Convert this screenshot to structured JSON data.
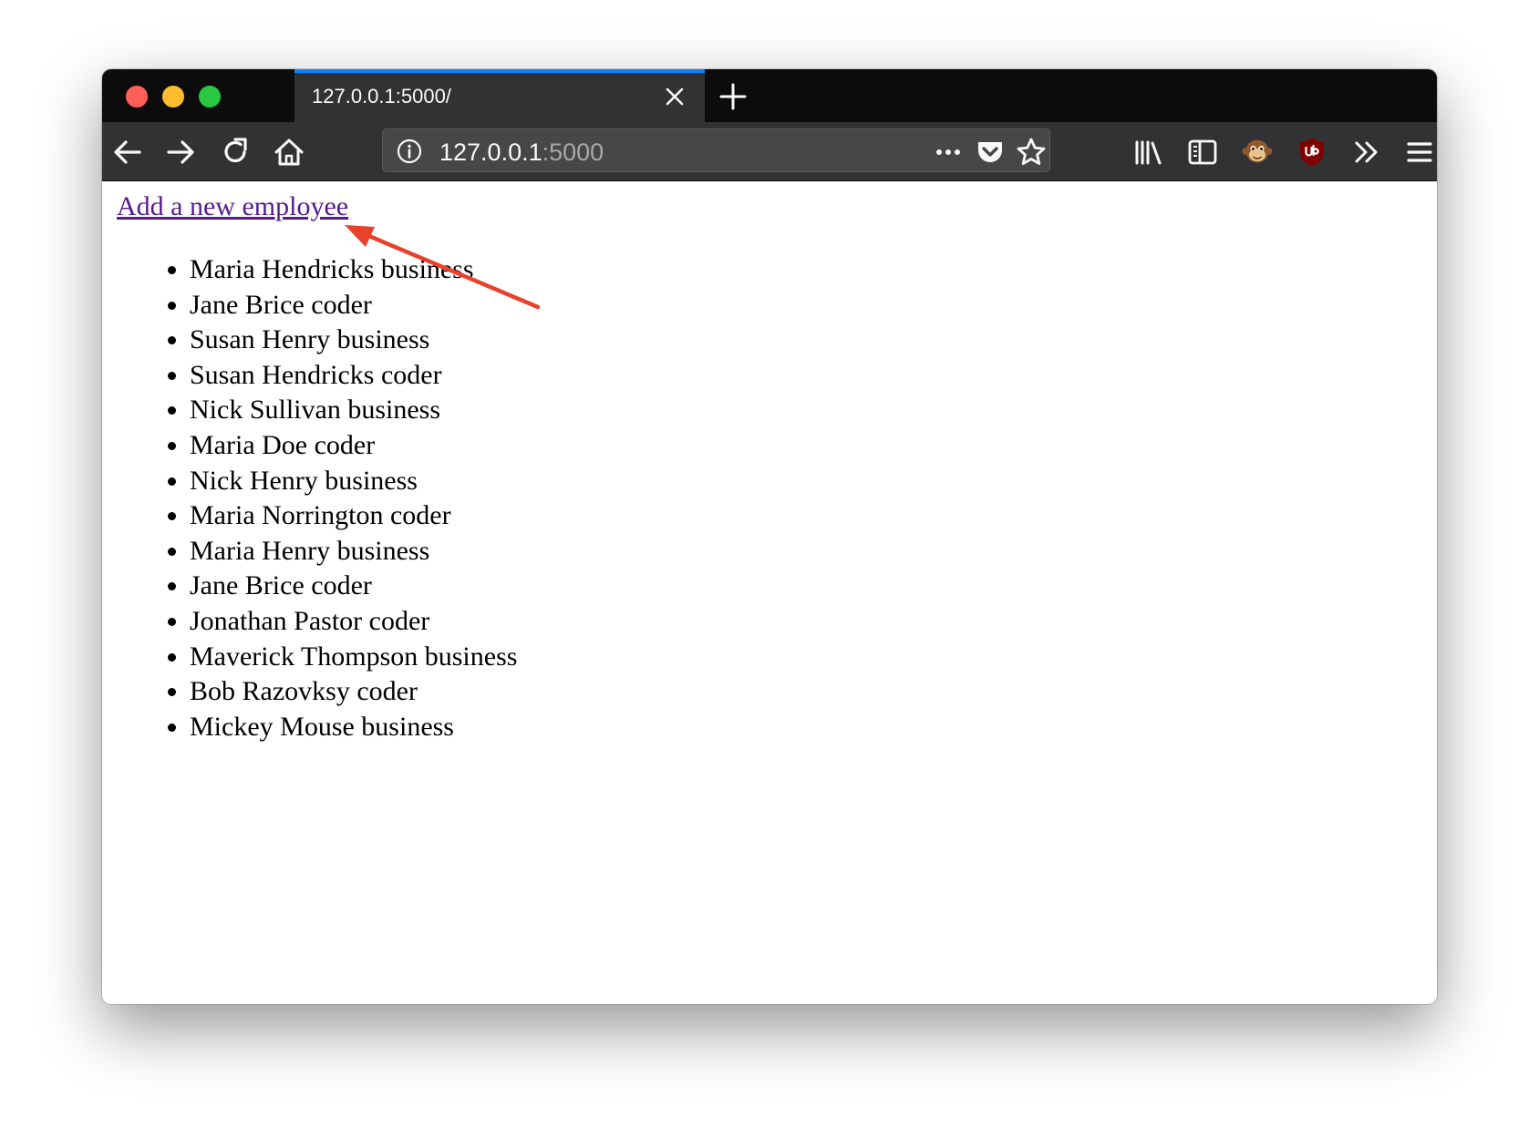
{
  "browser": {
    "tab": {
      "title": "127.0.0.1:5000/"
    },
    "url": {
      "host": "127.0.0.1",
      "port": ":5000"
    },
    "colors": {
      "accent": "#0a84ff",
      "traffic_close": "#fe5f57",
      "traffic_minimize": "#febc2e",
      "traffic_zoom": "#28c840"
    },
    "toolbar_icons": [
      "back-arrow-icon",
      "forward-arrow-icon",
      "reload-icon",
      "home-icon",
      "site-info-icon",
      "page-actions-icon",
      "pocket-icon",
      "bookmark-star-icon",
      "library-icon",
      "sidebar-icon",
      "tampermonkey-icon",
      "ublock-icon",
      "overflow-chevron-icon",
      "menu-icon"
    ]
  },
  "page": {
    "link_label": "Add a new employee",
    "link_color": "#551a8b",
    "employees": [
      "Maria Hendricks business",
      "Jane Brice coder",
      "Susan Henry business",
      "Susan Hendricks coder",
      "Nick Sullivan business",
      "Maria Doe coder",
      "Nick Henry business",
      "Maria Norrington coder",
      "Maria Henry business",
      "Jane Brice coder",
      "Jonathan Pastor coder",
      "Maverick Thompson business",
      "Bob Razovksy coder",
      "Mickey Mouse business"
    ]
  },
  "annotation": {
    "arrow_color": "#e8412c"
  }
}
